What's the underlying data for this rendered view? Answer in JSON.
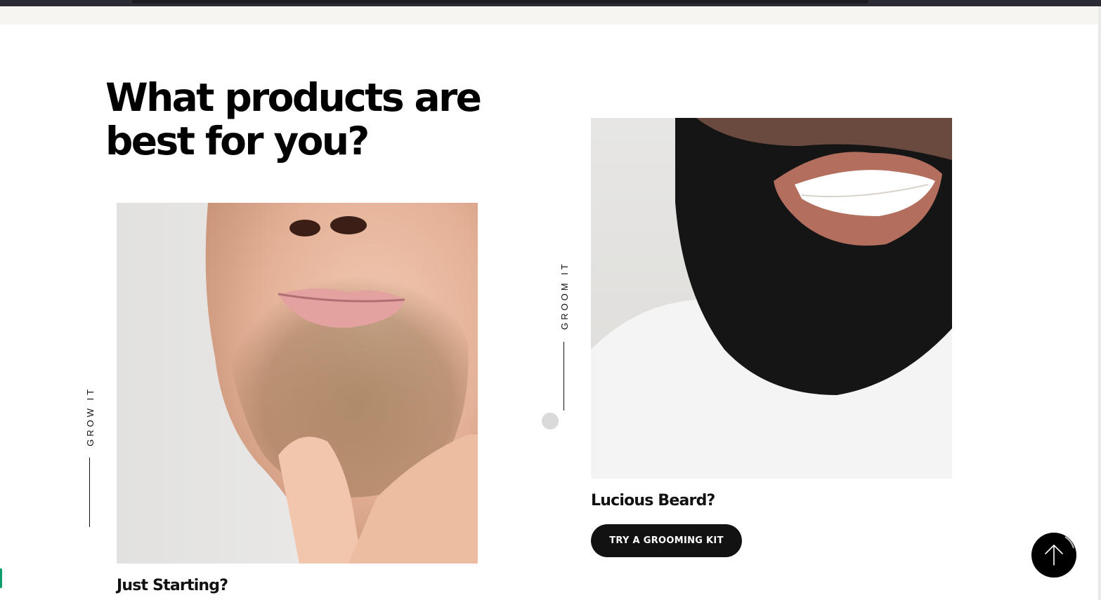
{
  "heading": {
    "line1": "What products are",
    "line2": "best for you?"
  },
  "cards": [
    {
      "tag": "GROW IT",
      "title": "Just Starting?",
      "image_alt": "Man with light stubble beard"
    },
    {
      "tag": "GROOM IT",
      "title": "Lucious Beard?",
      "image_alt": "Smiling man with full beard",
      "button_label": "TRY A GROOMING KIT"
    }
  ],
  "scroll_top": {
    "icon": "arrow-up-icon"
  },
  "colors": {
    "text": "#000000",
    "button_bg": "#121212",
    "button_text": "#ffffff",
    "banner_strip": "#f6f5f1",
    "browser_bar": "#2b2b33",
    "slider_dot": "#dadada",
    "edge_tab": "#0e9c6a"
  }
}
